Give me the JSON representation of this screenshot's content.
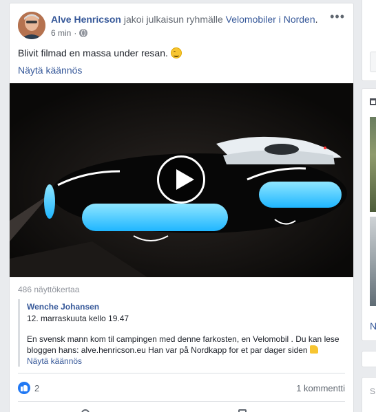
{
  "post": {
    "author": "Alve Henricson",
    "action": "jakoi julkaisun ryhmälle",
    "group": "Velomobiler i Norden",
    "group_suffix": ".",
    "time": "6 min",
    "privacy_icon": "globe-icon",
    "menu_label": "•••",
    "text": "Blivit filmad en massa under resan.",
    "text_emoji": "grinning-face-emoji",
    "translate_label": "Näytä käännös",
    "video": {
      "description": "Velomobile with glowing blue lights at night",
      "play_icon": "play-icon"
    },
    "views": "486 näyttökertaa",
    "shared": {
      "name": "Wenche Johansen",
      "date": "12. marraskuuta kello 19.47",
      "text": "En svensk mann kom til campingen med denne farkosten, en Velomobil . Du kan lese bloggen hans: alve.henricson.eu Han var på Nordkapp for et par dager siden",
      "text_emoji": "thumbs-up-emoji",
      "translate_label": "Näytä käännös"
    },
    "reactions": {
      "icon": "like-icon",
      "count": "2"
    },
    "comments": "1 kommentti"
  },
  "right_column": {
    "letter_n": "N",
    "letter_s": "S"
  },
  "colors": {
    "link": "#365899",
    "background": "#e9ebee",
    "like_blue": "#2078f4",
    "video_glow": "#46c8ff"
  }
}
